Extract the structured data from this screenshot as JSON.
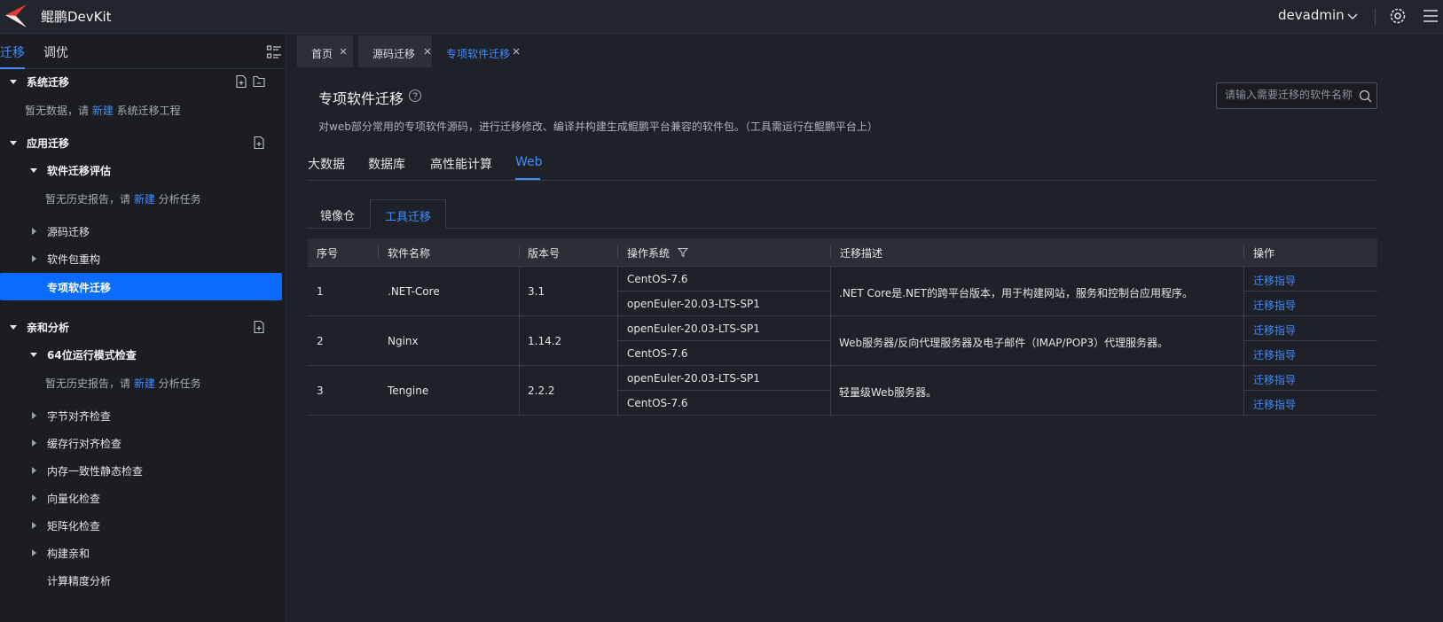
{
  "app": {
    "title": "鲲鹏DevKit",
    "user": "devadmin"
  },
  "sidebar": {
    "tabs": [
      "迁移",
      "调优"
    ],
    "sections": {
      "system": {
        "label": "系统迁移",
        "hint_pre": "暂无数据，请 ",
        "hint_link": "新建",
        "hint_post": " 系统迁移工程"
      },
      "app": {
        "label": "应用迁移"
      },
      "assess": {
        "label": "软件迁移评估",
        "hint_pre": "暂无历史报告，请 ",
        "hint_link": "新建",
        "hint_post": " 分析任务"
      },
      "source": {
        "label": "源码迁移"
      },
      "rebuild": {
        "label": "软件包重构"
      },
      "special": {
        "label": "专项软件迁移"
      },
      "affinity": {
        "label": "亲和分析"
      },
      "check64": {
        "label": "64位运行模式检查",
        "hint_pre": "暂无历史报告，请 ",
        "hint_link": "新建",
        "hint_post": " 分析任务"
      },
      "items": [
        "字节对齐检查",
        "缓存行对齐检查",
        "内存一致性静态检查",
        "向量化检查",
        "矩阵化检查",
        "构建亲和",
        "计算精度分析"
      ]
    }
  },
  "page_tabs": [
    "首页",
    "源码迁移",
    "专项软件迁移"
  ],
  "main": {
    "title": "专项软件迁移",
    "description": "对web部分常用的专项软件源码，进行迁移修改、编译并构建生成鲲鹏平台兼容的软件包。（工具需运行在鲲鹏平台上）",
    "search_placeholder": "请输入需要迁移的软件名称",
    "categories": [
      "大数据",
      "数据库",
      "高性能计算",
      "Web"
    ],
    "subtabs": [
      "镜像仓",
      "工具迁移"
    ],
    "table": {
      "headers": [
        "序号",
        "软件名称",
        "版本号",
        "操作系统",
        "迁移描述",
        "操作"
      ],
      "action": "迁移指导",
      "rows": [
        {
          "no": "1",
          "name": ".NET-Core",
          "version": "3.1",
          "os": [
            "CentOS-7.6",
            "openEuler-20.03-LTS-SP1"
          ],
          "desc": ".NET Core是.NET的跨平台版本，用于构建网站，服务和控制台应用程序。"
        },
        {
          "no": "2",
          "name": "Nginx",
          "version": "1.14.2",
          "os": [
            "openEuler-20.03-LTS-SP1",
            "CentOS-7.6"
          ],
          "desc": "Web服务器/反向代理服务器及电子邮件（IMAP/POP3）代理服务器。"
        },
        {
          "no": "3",
          "name": "Tengine",
          "version": "2.2.2",
          "os": [
            "openEuler-20.03-LTS-SP1",
            "CentOS-7.6"
          ],
          "desc": "轻量级Web服务器。"
        }
      ]
    }
  },
  "colors": {
    "accent": "#3f8cff",
    "selected": "#0a6cff",
    "background": "#1e2127",
    "sidebar": "#1b1d22"
  }
}
